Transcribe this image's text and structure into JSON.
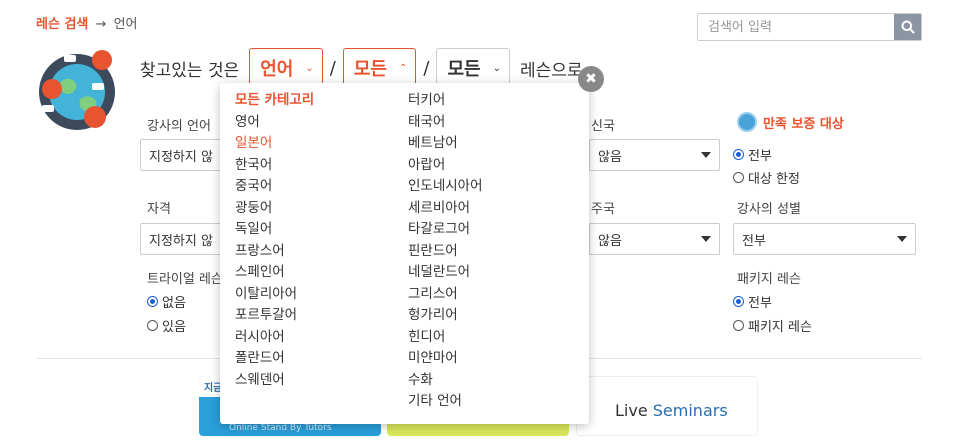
{
  "breadcrumb": {
    "link": "레슨 검색",
    "arrow": "→",
    "current": "언어"
  },
  "search": {
    "placeholder": "검색어 입력"
  },
  "headline": {
    "lead": "찾고있는 것은",
    "select_subject": "언어",
    "select_category": "모든",
    "select_type": "모든",
    "tail": "레슨으로."
  },
  "filters": {
    "teacher_language_label": "강사의 언어",
    "teacher_language_value": "지정하지 않",
    "country_label": "신국",
    "country_value": "않음",
    "qualification_label": "자격",
    "qualification_value": "지정하지 않",
    "residence_label": "주국",
    "residence_value": "않음",
    "trial_label": "트라이얼 레슨",
    "trial_options": [
      "없음",
      "있음"
    ],
    "guarantee_label": "만족 보증 대상",
    "guarantee_options": [
      "전부",
      "대상 한정"
    ],
    "gender_label": "강사의 성별",
    "gender_value": "전부",
    "package_label": "패키지 레슨",
    "package_options": [
      "전부",
      "패키지 레슨"
    ]
  },
  "dropdown": {
    "col1": [
      "모든 카테고리",
      "영어",
      "일본어",
      "한국어",
      "중국어",
      "광둥어",
      "독일어",
      "프랑스어",
      "스페인어",
      "이탈리아어",
      "포르투갈어",
      "러시아어",
      "폴란드어",
      "스웨덴어"
    ],
    "col2": [
      "터키어",
      "태국어",
      "베트남어",
      "아랍어",
      "인도네시아어",
      "세르비아어",
      "타갈로그어",
      "핀란드어",
      "네덜란드어",
      "그리스어",
      "헝가리어",
      "힌디어",
      "미얀마어",
      "수화",
      "기타 언어"
    ]
  },
  "banners": {
    "b1_tag": "지금",
    "b1_sub": "Online Stand By Tutors",
    "b3_text_pre": "Live ",
    "b3_text_s": "Seminars"
  },
  "close_label": "✖",
  "colors": {
    "accent": "#e8542f",
    "radio": "#1a5fd6",
    "search_btn": "#8b95a3"
  }
}
